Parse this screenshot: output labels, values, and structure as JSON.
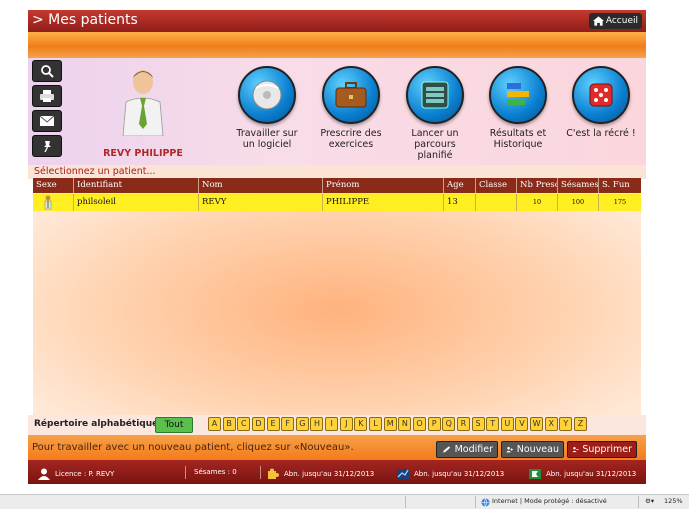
{
  "header": {
    "title": "> Mes patients",
    "home_label": "Accueil"
  },
  "patient": {
    "name": "REVY PHILIPPE"
  },
  "tools": [
    {
      "label1": "Travailler sur",
      "label2": "un logiciel"
    },
    {
      "label1": "Prescrire des",
      "label2": "exercices"
    },
    {
      "label1": "Lancer un parcours",
      "label2": "planifié"
    },
    {
      "label1": "Résultats et",
      "label2": "Historique"
    },
    {
      "label1": "C'est la récré !",
      "label2": ""
    }
  ],
  "select_prompt": "Sélectionnez un patient...",
  "table": {
    "columns": [
      "Sexe",
      "Identifiant",
      "Nom",
      "Prénom",
      "Age",
      "Classe",
      "Nb Presc",
      "Sésames",
      "S. Fun"
    ],
    "rows": [
      {
        "sexe": "",
        "identifiant": "philsoleil",
        "nom": "REVY",
        "prenom": "PHILIPPE",
        "age": "13",
        "classe": "",
        "nb_presc": "10",
        "sesames": "100",
        "s_fun": "175"
      }
    ]
  },
  "alpha": {
    "label": "Répertoire alphabétique :",
    "all_label": "Tout",
    "letters": [
      "A",
      "B",
      "C",
      "D",
      "E",
      "F",
      "G",
      "H",
      "I",
      "J",
      "K",
      "L",
      "M",
      "N",
      "O",
      "P",
      "Q",
      "R",
      "S",
      "T",
      "U",
      "V",
      "W",
      "X",
      "Y",
      "Z"
    ]
  },
  "actions": {
    "message": "Pour travailler avec un nouveau patient, cliquez sur «Nouveau».",
    "modify": "Modifier",
    "new": "Nouveau",
    "delete": "Supprimer"
  },
  "status": {
    "licence": "Licence : P. REVY",
    "sesames": "Sésames :  0",
    "abn1": "Abn. jusqu'au 31/12/2013",
    "abn2": "Abn. jusqu'au 31/12/2013",
    "abn3": "Abn. jusqu'au 31/12/2013"
  },
  "browser": {
    "zone": "Internet | Mode protégé : désactivé",
    "zoom": "125%"
  },
  "colors": {
    "accent_red": "#a42520",
    "accent_orange": "#f47b1a",
    "row_highlight": "#ffee22"
  }
}
